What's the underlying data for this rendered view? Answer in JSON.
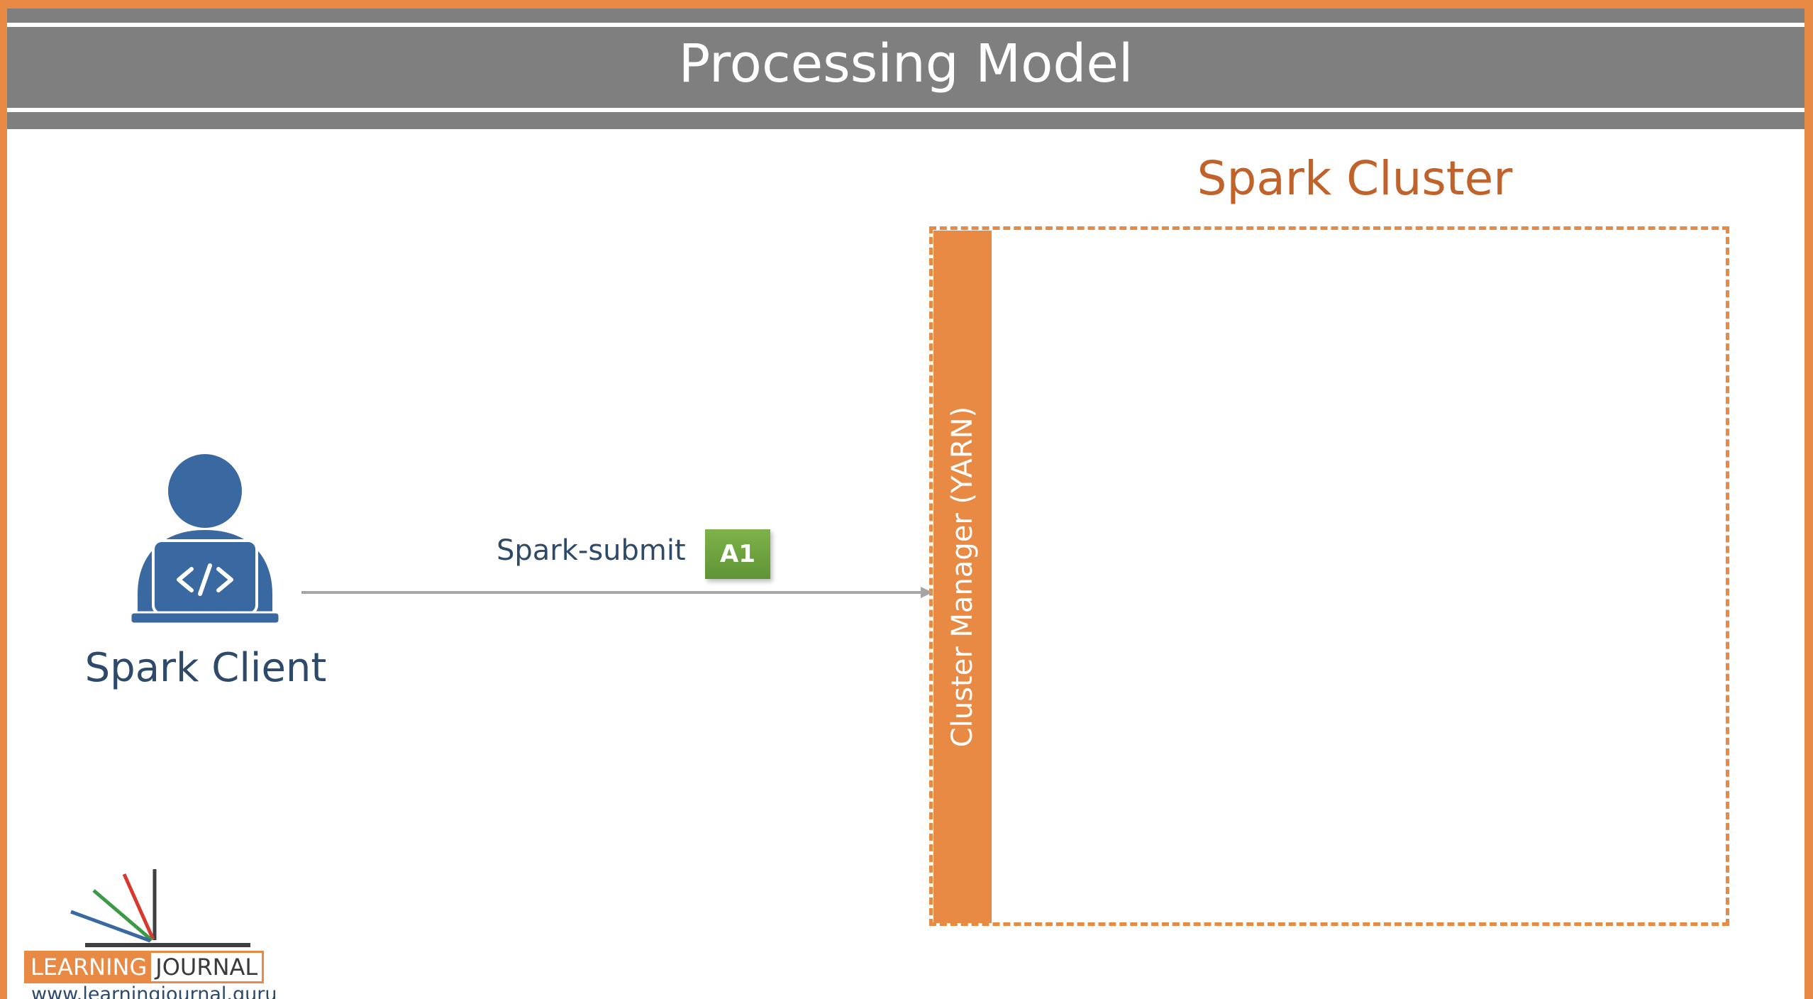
{
  "header": {
    "title": "Processing Model"
  },
  "cluster": {
    "title": "Spark Cluster",
    "manager_label": "Cluster Manager (YARN)"
  },
  "client": {
    "label": "Spark Client",
    "icon": "developer-laptop-icon"
  },
  "submission": {
    "label": "Spark-submit",
    "app_badge": "A1"
  },
  "branding": {
    "logo_left": "LEARNING",
    "logo_right": "JOURNAL",
    "url": "www.learningjournal.guru"
  },
  "colors": {
    "accent_orange": "#e88a44",
    "title_gray": "#7f7f7f",
    "text_blue": "#2e4a6b",
    "cluster_title": "#c0622a",
    "badge_green": "#6aa33d",
    "icon_blue": "#3a68a0"
  }
}
